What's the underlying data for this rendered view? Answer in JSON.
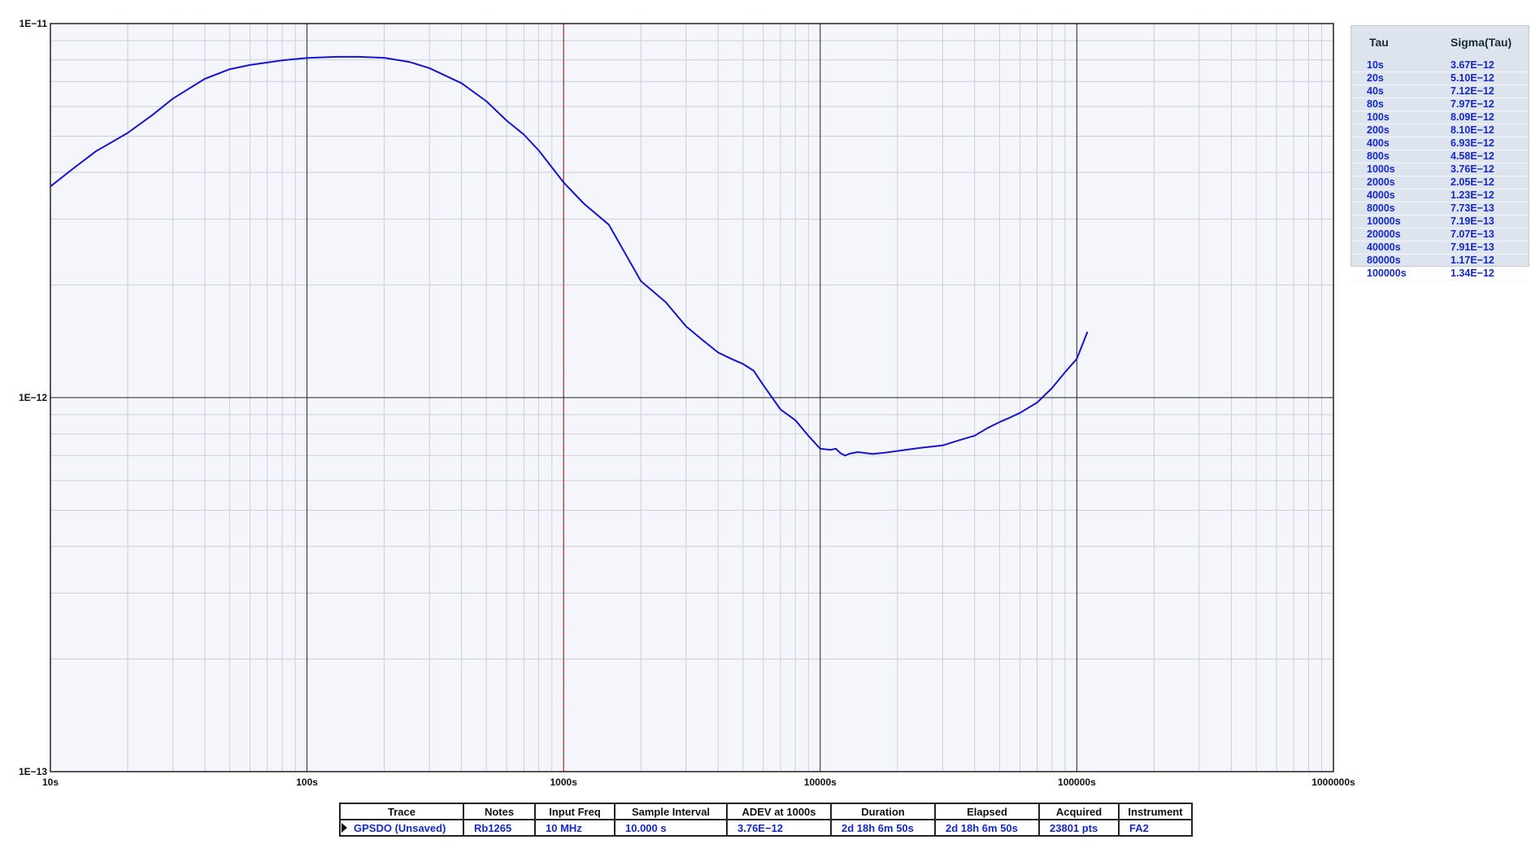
{
  "chart_data": {
    "type": "line",
    "title": "",
    "x_scale": "log",
    "y_scale": "log",
    "xlim": [
      10,
      1000000
    ],
    "ylim": [
      1e-13,
      1e-11
    ],
    "x_tick_labels": [
      "10s",
      "100s",
      "1000s",
      "10000s",
      "100000s",
      "1000000s"
    ],
    "x_tick_values": [
      10,
      100,
      1000,
      10000,
      100000,
      1000000
    ],
    "y_tick_labels": [
      "1E−11",
      "1E−12",
      "1E−13"
    ],
    "y_tick_values": [
      1e-11,
      1e-12,
      1e-13
    ],
    "grid": true,
    "marker_line": {
      "x": 1000,
      "style": "dashed",
      "color": "#e8202a"
    },
    "colors": {
      "trace": "#1414d2",
      "plot_bg": "#f4f6fb",
      "grid_minor": "#c9d0da",
      "grid_major": "#222222"
    },
    "series": [
      {
        "x": [
          10,
          12,
          15,
          20,
          25,
          30,
          40,
          50,
          60,
          80,
          100,
          130,
          160,
          200,
          250,
          300,
          400,
          500,
          600,
          700,
          800,
          1000,
          1200,
          1500,
          2000,
          2500,
          3000,
          3500,
          4000,
          4500,
          5000,
          5500,
          6000,
          7000,
          8000,
          9000,
          10000,
          11000,
          11500,
          12000,
          12500,
          13000,
          14000,
          16000,
          18000,
          20000,
          25000,
          30000,
          35000,
          40000,
          45000,
          50000,
          55000,
          60000,
          70000,
          80000,
          90000,
          100000,
          110000
        ],
        "y": [
          3.67e-12,
          4.05e-12,
          4.55e-12,
          5.1e-12,
          5.7e-12,
          6.3e-12,
          7.12e-12,
          7.55e-12,
          7.75e-12,
          7.97e-12,
          8.09e-12,
          8.15e-12,
          8.15e-12,
          8.1e-12,
          7.9e-12,
          7.6e-12,
          6.93e-12,
          6.2e-12,
          5.5e-12,
          5.05e-12,
          4.58e-12,
          3.76e-12,
          3.3e-12,
          2.9e-12,
          2.05e-12,
          1.8e-12,
          1.55e-12,
          1.42e-12,
          1.32e-12,
          1.27e-12,
          1.23e-12,
          1.18e-12,
          1.08e-12,
          9.3e-13,
          8.7e-13,
          7.9e-13,
          7.3e-13,
          7.25e-13,
          7.3e-13,
          7.1e-13,
          7e-13,
          7.08e-13,
          7.15e-13,
          7.07e-13,
          7.13e-13,
          7.2e-13,
          7.35e-13,
          7.45e-13,
          7.7e-13,
          7.91e-13,
          8.3e-13,
          8.6e-13,
          8.85e-13,
          9.1e-13,
          9.7e-13,
          1.06e-12,
          1.17e-12,
          1.27e-12,
          1.5e-12
        ]
      }
    ]
  },
  "tau_table": {
    "header_tau": "Tau",
    "header_sigma": "Sigma(Tau)",
    "rows": [
      {
        "tau": "10s",
        "sigma": "3.67E−12"
      },
      {
        "tau": "20s",
        "sigma": "5.10E−12"
      },
      {
        "tau": "40s",
        "sigma": "7.12E−12"
      },
      {
        "tau": "80s",
        "sigma": "7.97E−12"
      },
      {
        "tau": "100s",
        "sigma": "8.09E−12"
      },
      {
        "tau": "200s",
        "sigma": "8.10E−12"
      },
      {
        "tau": "400s",
        "sigma": "6.93E−12"
      },
      {
        "tau": "800s",
        "sigma": "4.58E−12"
      },
      {
        "tau": "1000s",
        "sigma": "3.76E−12"
      },
      {
        "tau": "2000s",
        "sigma": "2.05E−12"
      },
      {
        "tau": "4000s",
        "sigma": "1.23E−12"
      },
      {
        "tau": "8000s",
        "sigma": "7.73E−13"
      },
      {
        "tau": "10000s",
        "sigma": "7.19E−13"
      },
      {
        "tau": "20000s",
        "sigma": "7.07E−13"
      },
      {
        "tau": "40000s",
        "sigma": "7.91E−13"
      },
      {
        "tau": "80000s",
        "sigma": "1.17E−12"
      },
      {
        "tau": "100000s",
        "sigma": "1.34E−12"
      }
    ]
  },
  "info_table": {
    "headers": {
      "trace": "Trace",
      "notes": "Notes",
      "input_freq": "Input Freq",
      "sample_interval": "Sample Interval",
      "adev": "ADEV at 1000s",
      "duration": "Duration",
      "elapsed": "Elapsed",
      "acquired": "Acquired",
      "instrument": "Instrument"
    },
    "row": {
      "trace": "GPSDO (Unsaved)",
      "notes": "Rb1265",
      "input_freq": "10 MHz",
      "sample_interval": "10.000 s",
      "adev": "3.76E−12",
      "duration": "2d 18h 6m 50s",
      "elapsed": "2d 18h 6m 50s",
      "acquired": "23801 pts",
      "instrument": "FA2"
    },
    "colors": {
      "adev_header": "#e0101a",
      "values": "#1428c8"
    }
  }
}
